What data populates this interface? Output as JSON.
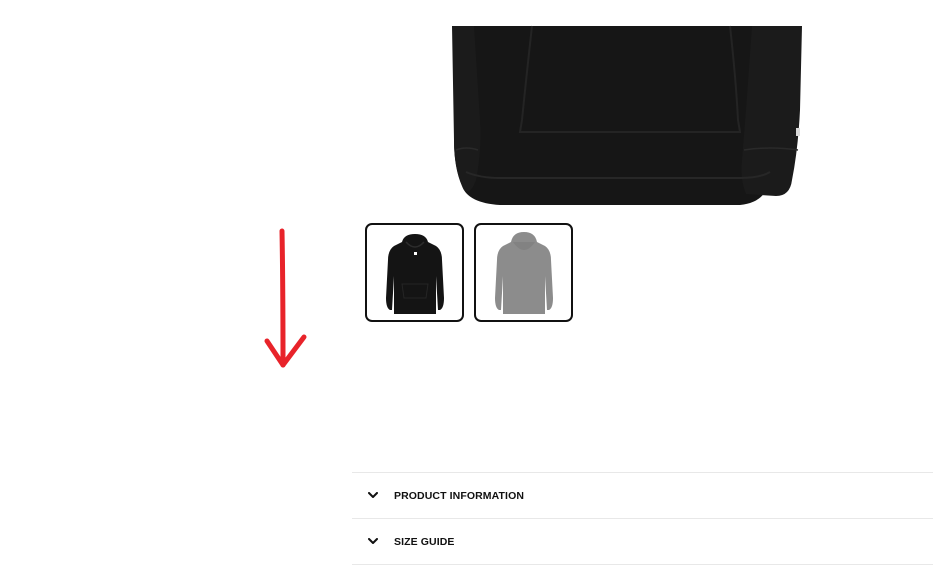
{
  "product_gallery": {
    "main_image": {
      "icon": "hoodie-front-black-image"
    },
    "thumbnails": [
      {
        "icon": "hoodie-black-front-thumbnail",
        "color": "#141414",
        "selected": true
      },
      {
        "icon": "hoodie-grey-back-thumbnail",
        "color": "#8a8a8a",
        "selected": false
      }
    ]
  },
  "annotation": {
    "icon": "red-down-arrow",
    "color": "#e8232a"
  },
  "accordion": {
    "items": [
      {
        "label": "PRODUCT INFORMATION",
        "icon": "chevron-down-icon"
      },
      {
        "label": "SIZE GUIDE",
        "icon": "chevron-down-icon"
      }
    ]
  }
}
